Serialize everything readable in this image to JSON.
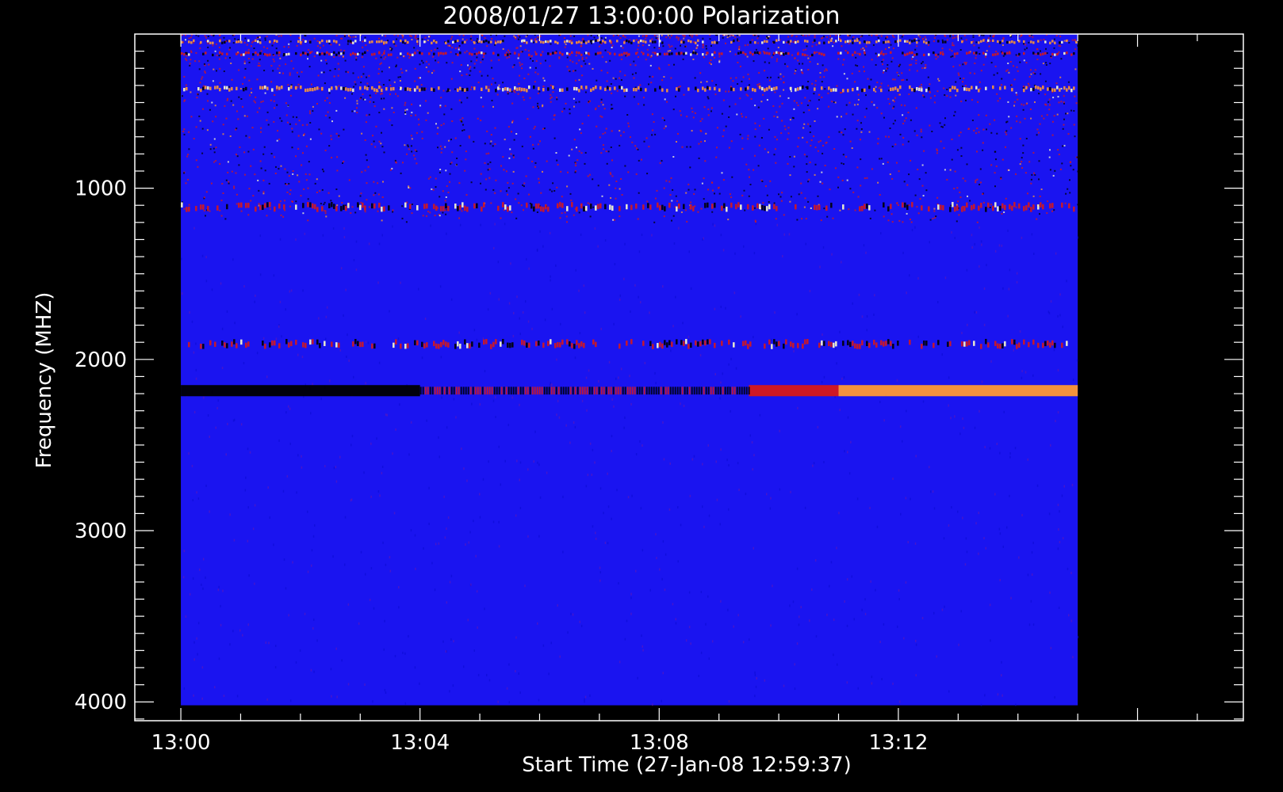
{
  "chart_data": {
    "type": "heatmap",
    "title": "2008/01/27 13:00:00 Polarization",
    "xlabel": "Start Time (27-Jan-08 12:59:37)",
    "ylabel": "Frequency (MHZ)",
    "x_ticks": [
      {
        "label": "13:00",
        "minute": 0
      },
      {
        "label": "13:04",
        "minute": 4
      },
      {
        "label": "13:08",
        "minute": 8
      },
      {
        "label": "13:12",
        "minute": 12
      }
    ],
    "xlim_minutes": [
      -0.77,
      17.77
    ],
    "data_x_range_minutes": [
      0,
      15
    ],
    "y_ticks": [
      1000,
      2000,
      3000,
      4000
    ],
    "ylim": [
      100,
      4110
    ],
    "data_y_range": [
      100,
      4020
    ],
    "y_reversed": true,
    "grid": false,
    "colormap": {
      "background": "#000000",
      "base": "#1a14f0",
      "mid": "#d81818",
      "high": "#ff9933",
      "peak": "#ffffcc"
    },
    "features": [
      {
        "name": "rfi-band",
        "freq_from": 130,
        "freq_to": 160,
        "t_from": 0,
        "t_to": 15,
        "level": "high"
      },
      {
        "name": "rfi-band",
        "freq_from": 200,
        "freq_to": 230,
        "t_from": 0,
        "t_to": 15,
        "level": "mid"
      },
      {
        "name": "rfi-band",
        "freq_from": 400,
        "freq_to": 440,
        "t_from": 0,
        "t_to": 15,
        "level": "high"
      },
      {
        "name": "rfi-band",
        "freq_from": 1080,
        "freq_to": 1140,
        "t_from": 0,
        "t_to": 15,
        "level": "mid"
      },
      {
        "name": "band",
        "freq_from": 1880,
        "freq_to": 1940,
        "t_from": 0,
        "t_to": 15,
        "level": "mid"
      },
      {
        "name": "dark-band",
        "freq_from": 2150,
        "freq_to": 2215,
        "t_from": 0,
        "t_to": 4,
        "level": "none"
      },
      {
        "name": "emission-band",
        "freq_from": 2150,
        "freq_to": 2215,
        "t_from": 9.5,
        "t_to": 11,
        "level": "mid"
      },
      {
        "name": "emission-band",
        "freq_from": 2150,
        "freq_to": 2215,
        "t_from": 11,
        "t_to": 15,
        "level": "high"
      }
    ]
  }
}
